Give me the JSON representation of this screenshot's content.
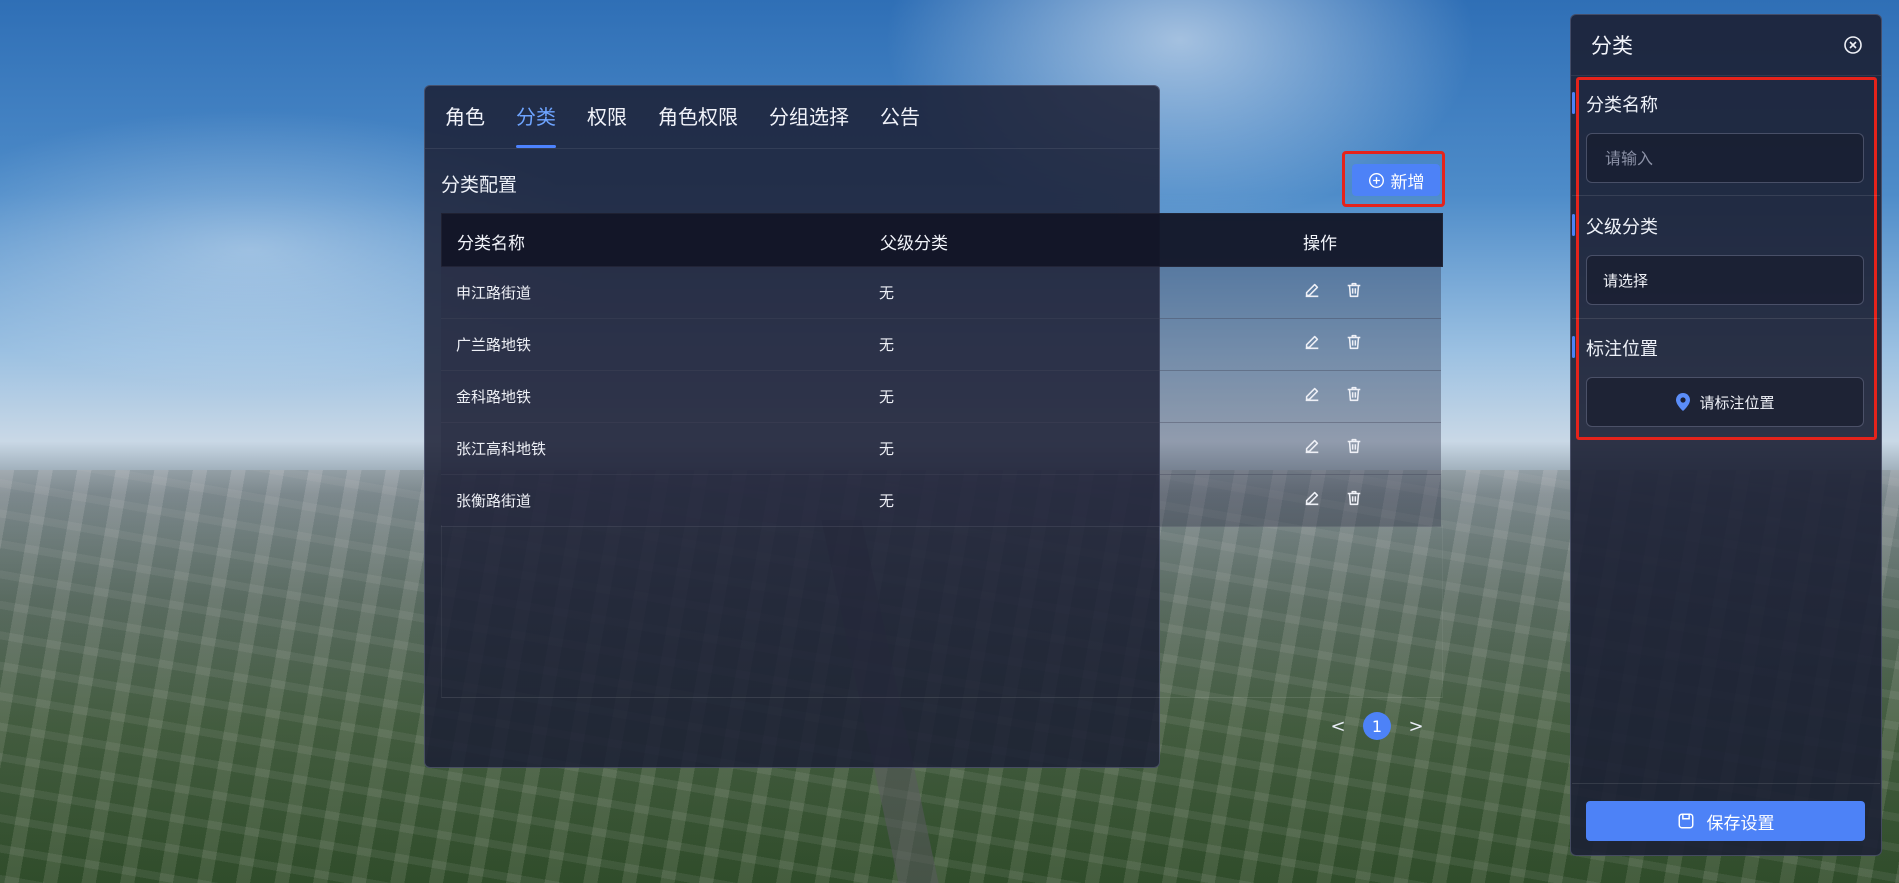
{
  "tabs": [
    {
      "label": "角色"
    },
    {
      "label": "分类"
    },
    {
      "label": "权限"
    },
    {
      "label": "角色权限"
    },
    {
      "label": "分组选择"
    },
    {
      "label": "公告"
    }
  ],
  "active_tab": "分类",
  "section": {
    "title": "分类配置",
    "add_label": "新增"
  },
  "table": {
    "columns": [
      "分类名称",
      "父级分类",
      "操作"
    ],
    "rows": [
      {
        "name": "申江路街道",
        "parent": "无"
      },
      {
        "name": "广兰路地铁",
        "parent": "无"
      },
      {
        "name": "金科路地铁",
        "parent": "无"
      },
      {
        "name": "张江高科地铁",
        "parent": "无"
      },
      {
        "name": "张衡路街道",
        "parent": "无"
      }
    ]
  },
  "pagination": {
    "prev": "<",
    "current": "1",
    "next": ">"
  },
  "side": {
    "title": "分类",
    "fields": {
      "name_label": "分类名称",
      "name_placeholder": "请输入",
      "parent_label": "父级分类",
      "parent_value": "请选择",
      "location_label": "标注位置",
      "location_button": "请标注位置"
    },
    "save_label": "保存设置"
  },
  "colors": {
    "accent": "#4d82f7",
    "highlight": "#e5231b",
    "panel": "#1c2034"
  }
}
